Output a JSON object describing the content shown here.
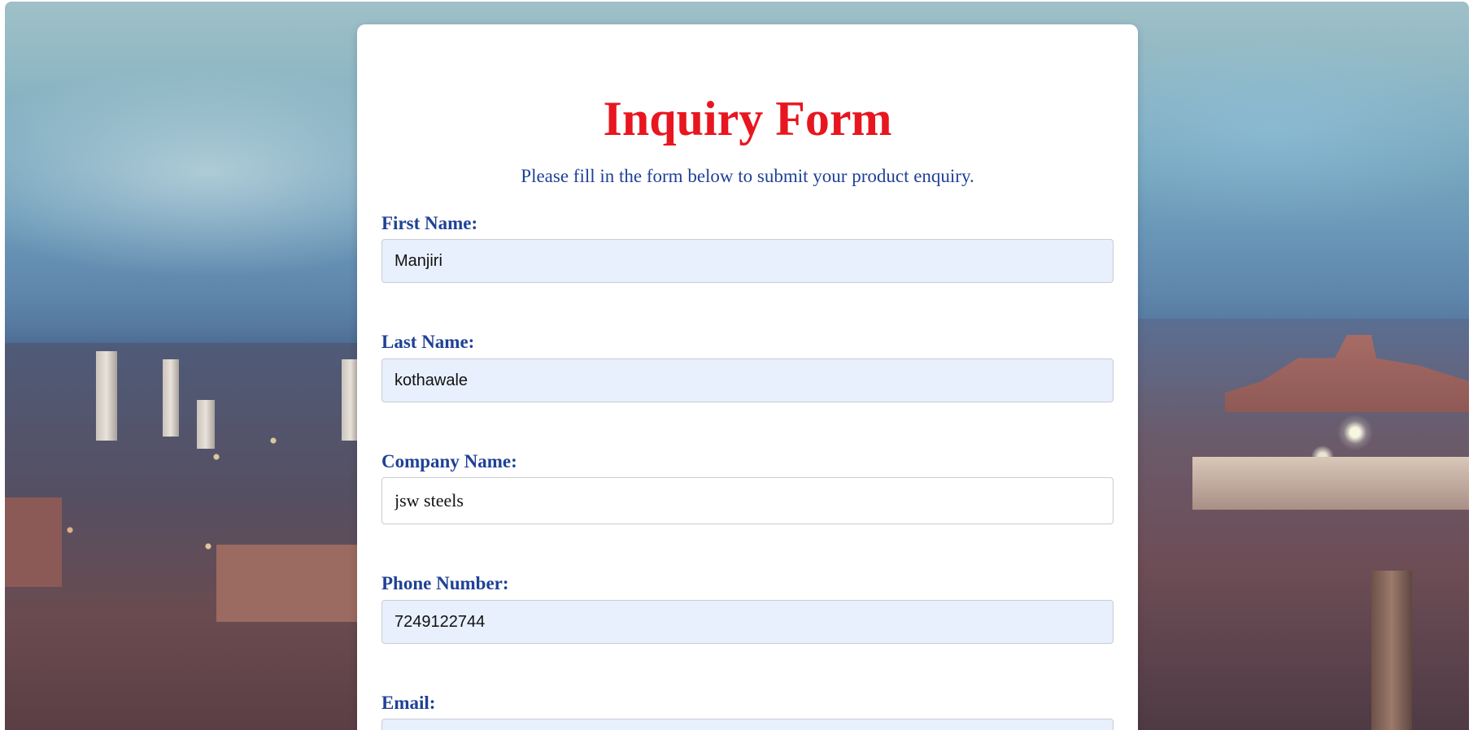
{
  "form": {
    "title": "Inquiry Form",
    "subtitle": "Please fill in the form below to submit your product enquiry.",
    "fields": {
      "first_name": {
        "label": "First Name:",
        "value": "Manjiri"
      },
      "last_name": {
        "label": "Last Name:",
        "value": "kothawale"
      },
      "company_name": {
        "label": "Company Name:",
        "value": "jsw steels"
      },
      "phone_number": {
        "label": "Phone Number:",
        "value": "7249122744"
      },
      "email": {
        "label": "Email:",
        "value": ""
      }
    }
  },
  "colors": {
    "title": "#e8161f",
    "label": "#1f4196",
    "autofill_background": "#e8f0fe"
  }
}
